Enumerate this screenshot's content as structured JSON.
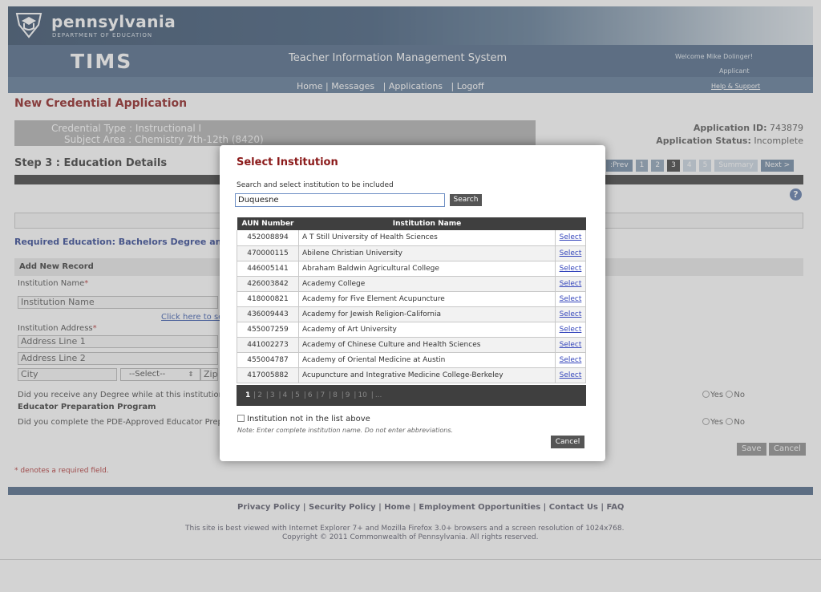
{
  "header": {
    "logo_title": "pennsylvania",
    "logo_subtitle": "DEPARTMENT OF EDUCATION",
    "app_name": "TIMS",
    "system_title": "Teacher Information Management System",
    "welcome": "Welcome Mike Dolinger!",
    "role": "Applicant",
    "nav": [
      "Home",
      "Messages",
      "Applications",
      "Logoff"
    ],
    "help": "Help & Support"
  },
  "page": {
    "title": "New Credential Application",
    "credential_type": "Credential Type : Instructional I",
    "subject_area": "Subject Area : Chemistry 7th-12th (8420)",
    "application_id_label": "Application ID:",
    "application_id": "743879",
    "status_label": "Application Status:",
    "status": "Incomplete",
    "step_title": "Step 3 : Education Details",
    "step_nav": [
      ":Prev",
      "1",
      "2",
      "3",
      "4",
      "5",
      "Summary",
      "Next >"
    ],
    "required_education": "Required Education: Bachelors Degree and",
    "add_new_record": "Add New Record",
    "institution_name_label": "Institution Name",
    "institution_name_placeholder": "Institution Name",
    "click_here": "Click here to se",
    "institution_address_label": "Institution Address",
    "address1_placeholder": "Address Line 1",
    "address2_placeholder": "Address Line 2",
    "city_placeholder": "City",
    "state_select": "--Select--",
    "zip_placeholder": "Zip",
    "degree_question": "Did you receive any Degree while at this institution?",
    "educator_prep_heading": "Educator Preparation Program",
    "pde_question": "Did you complete the PDE-Approved Educator Prepa",
    "yes": "Yes",
    "no": "No",
    "save": "Save",
    "cancel": "Cancel",
    "required_note": "* denotes a required field."
  },
  "footer": {
    "links": "Privacy Policy | Security Policy | Home | Employment Opportunities | Contact Us | FAQ",
    "note1": "This site is best viewed with Internet Explorer 7+ and Mozilla Firefox 3.0+ browsers and a screen resolution of 1024x768.",
    "note2": "Copyright © 2011 Commonwealth of Pennsylvania. All rights reserved."
  },
  "modal": {
    "title": "Select Institution",
    "description": "Search and select institution to be included",
    "search_value": "Duquesne",
    "search_button": "Search",
    "col_aun": "AUN Number",
    "col_name": "Institution Name",
    "select_label": "Select",
    "rows": [
      {
        "aun": "452008894",
        "name": "A T Still University of Health Sciences"
      },
      {
        "aun": "470000115",
        "name": "Abilene Christian University"
      },
      {
        "aun": "446005141",
        "name": "Abraham Baldwin Agricultural College"
      },
      {
        "aun": "426003842",
        "name": "Academy College"
      },
      {
        "aun": "418000821",
        "name": "Academy for Five Element Acupuncture"
      },
      {
        "aun": "436009443",
        "name": "Academy for Jewish Religion-California"
      },
      {
        "aun": "455007259",
        "name": "Academy of Art University"
      },
      {
        "aun": "441002273",
        "name": "Academy of Chinese Culture and Health Sciences"
      },
      {
        "aun": "455004787",
        "name": "Academy of Oriental Medicine at Austin"
      },
      {
        "aun": "417005882",
        "name": "Acupuncture and Integrative Medicine College-Berkeley"
      }
    ],
    "pages": [
      "1",
      "2",
      "3",
      "4",
      "5",
      "6",
      "7",
      "8",
      "9",
      "10",
      "..."
    ],
    "not_in_list": "Institution not in the list above",
    "note": "Note: Enter complete institution name. Do not enter abbreviations.",
    "cancel": "Cancel"
  }
}
